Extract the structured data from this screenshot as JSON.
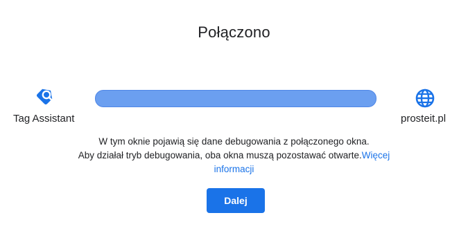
{
  "title": "Połączono",
  "source": {
    "label": "Tag Assistant",
    "icon": "tag-assistant-icon"
  },
  "target": {
    "label": "prosteit.pl",
    "icon": "globe-icon"
  },
  "connection_bar_color": "#6b9ff0",
  "description": {
    "line1": "W tym oknie pojawią się dane debugowania z połączonego okna.",
    "line2": "Aby działał tryb debugowania, oba okna muszą pozostawać otwarte.",
    "link_part1": "Więcej",
    "link_part2": "informacji"
  },
  "continue_button": {
    "label": "Dalej"
  },
  "colors": {
    "accent": "#1a73e8",
    "text": "#202124"
  }
}
